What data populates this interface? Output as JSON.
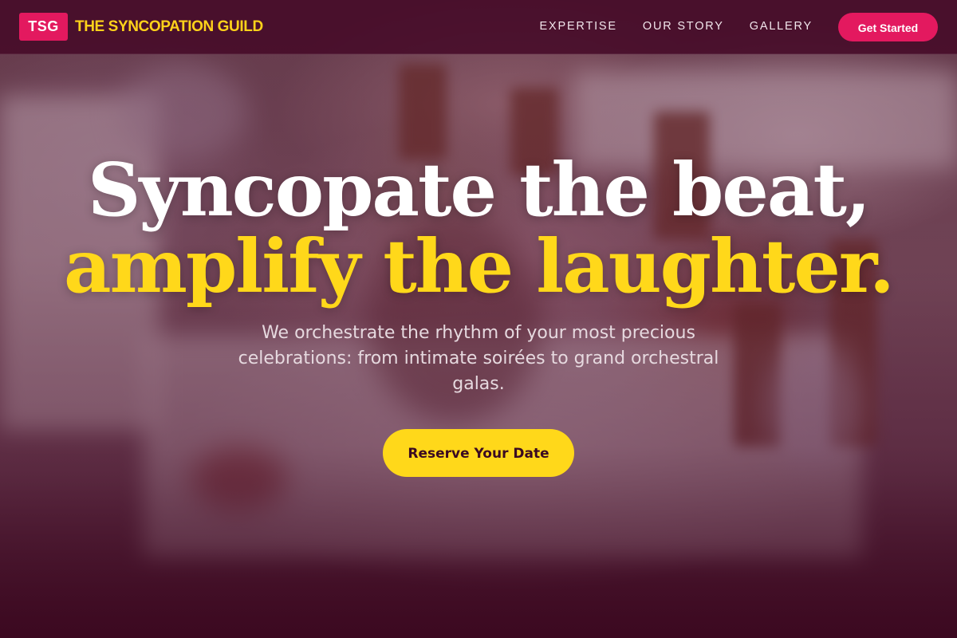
{
  "brand": {
    "badge": "TSG",
    "name": "THE SYNCOPATION GUILD"
  },
  "nav": {
    "links": [
      "EXPERTISE",
      "OUR STORY",
      "GALLERY"
    ],
    "cta_label": "Get Started"
  },
  "hero": {
    "headline_line1": "Syncopate the beat,",
    "headline_line2": "amplify the laughter.",
    "subtitle": "We orchestrate the rhythm of your most precious celebrations: from intimate soirées to grand orchestral galas.",
    "button_label": "Reserve Your Date",
    "background_image": "blurred-banquet-tables-photo"
  },
  "colors": {
    "accent_pink": "#e3195f",
    "accent_yellow": "#ffd81a",
    "overlay_plum": "#3a0f26"
  }
}
